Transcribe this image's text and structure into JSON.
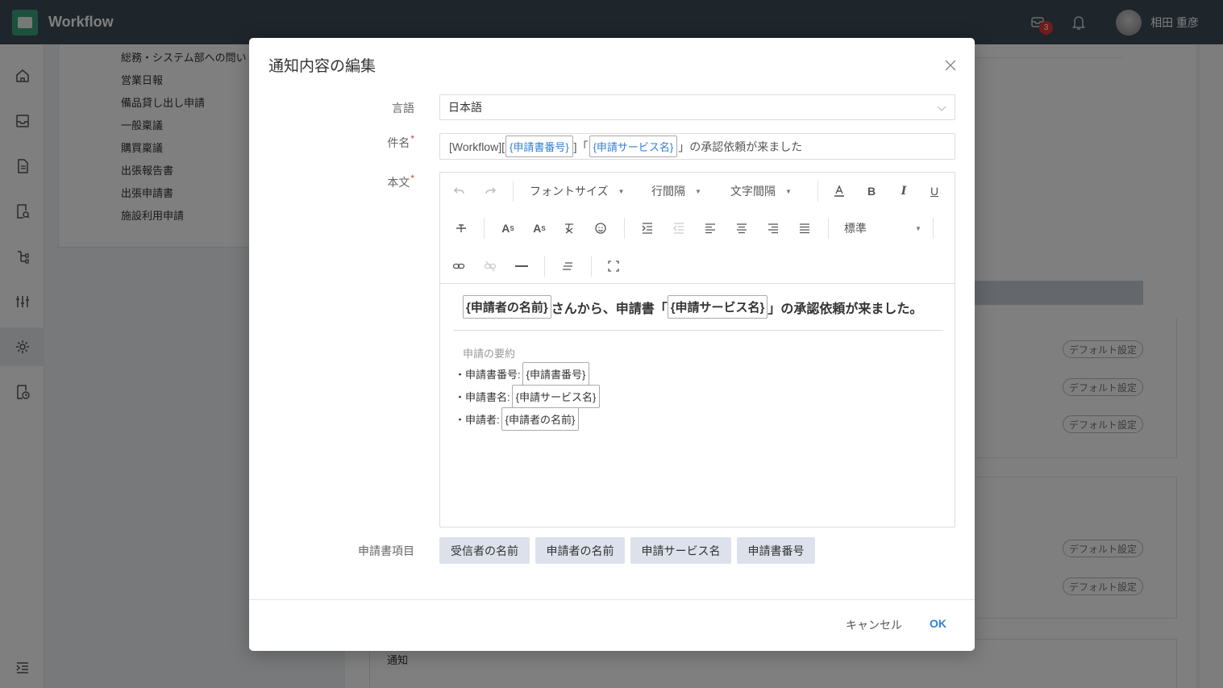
{
  "topbar": {
    "app_title": "Workflow",
    "mail_badge": "3",
    "user_name": "相田 重彦"
  },
  "background": {
    "forms": [
      "総務・システム部への問い",
      "営業日報",
      "備品貸し出し申請",
      "一般稟議",
      "購買稟議",
      "出張報告書",
      "出張申請書",
      "施設利用申請"
    ],
    "default_label": "デフォルト設定",
    "notice_label": "通知"
  },
  "modal": {
    "title": "通知内容の編集",
    "language_label": "言語",
    "language_value": "日本語",
    "subject_label": "件名",
    "subject": {
      "prefix": "[Workflow][",
      "tag1": "{申請書番号}",
      "middle": "]「",
      "tag2": "{申請サービス名}",
      "suffix": "」の承認依頼が来ました"
    },
    "body_label": "本文",
    "toolbar": {
      "font_size": "フォントサイズ",
      "line_height": "行間隔",
      "letter_spacing": "文字間隔",
      "paragraph": "標準"
    },
    "body": {
      "tag_requester": "{申請者の名前}",
      "text1": "さんから、申請書「",
      "tag_service": "{申請サービス名}",
      "text2": "」の承認依頼が来ました。",
      "summary_title": "申請の要約",
      "lines": [
        {
          "label": "・申請書番号:",
          "tag": "{申請書番号}"
        },
        {
          "label": "・申請書名:",
          "tag": "{申請サービス名}"
        },
        {
          "label": "・申請者:",
          "tag": "{申請者の名前}"
        }
      ]
    },
    "items_label": "申請書項目",
    "items": [
      "受信者の名前",
      "申請者の名前",
      "申請サービス名",
      "申請書番号"
    ],
    "cancel": "キャンセル",
    "ok": "OK"
  }
}
